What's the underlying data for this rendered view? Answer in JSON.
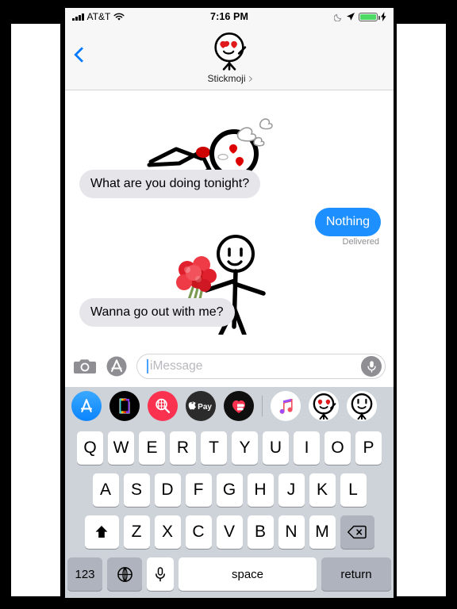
{
  "status_bar": {
    "carrier": "AT&T",
    "time": "7:16 PM",
    "signal_icon": "cellular-bars-icon",
    "wifi_icon": "wifi-icon",
    "dnd_icon": "moon-icon",
    "location_icon": "location-arrow-icon",
    "battery_icon": "battery-icon",
    "charging_icon": "lightning-bolt-icon",
    "battery_color": "#4cd964"
  },
  "nav": {
    "back_icon": "back-chevron-icon",
    "contact_name": "Stickmoji",
    "contact_chevron_icon": "chevron-right-icon",
    "avatar_icon": "stickmoji-heart-eyes-avatar",
    "accent_color": "#007aff"
  },
  "conversation": {
    "messages": [
      {
        "id": "b1",
        "text": "What are you doing tonight?",
        "side": "in",
        "sticker": "stick-figure-lying-hearts-sticker"
      },
      {
        "id": "b2",
        "text": "Nothing",
        "side": "out",
        "status": "Delivered"
      },
      {
        "id": "b3",
        "text": "Wanna go out with me?",
        "side": "in",
        "sticker": "stick-figure-roses-sticker"
      }
    ],
    "delivered_label": "Delivered",
    "incoming_bubble_color": "#e5e5ea",
    "outgoing_bubble_color": "#1e8fff"
  },
  "input_bar": {
    "camera_icon": "camera-icon",
    "appstore_icon": "app-store-icon",
    "placeholder": "iMessage",
    "value": "",
    "mic_icon": "microphone-icon"
  },
  "app_drawer": {
    "apps": [
      {
        "name": "app-store-app-icon",
        "label": "App Store"
      },
      {
        "name": "photos-app-icon",
        "label": "Photos"
      },
      {
        "name": "images-search-app-icon",
        "label": "#images"
      },
      {
        "name": "apple-pay-app-icon",
        "label": "Apple Pay"
      },
      {
        "name": "digital-touch-app-icon",
        "label": "Digital Touch"
      },
      {
        "name": "music-app-icon",
        "label": "Music"
      },
      {
        "name": "stickmoji-hearts-app-icon",
        "label": "Stickmoji"
      },
      {
        "name": "stickmoji-plain-app-icon",
        "label": "Stickmoji"
      }
    ]
  },
  "keyboard": {
    "row1": [
      "Q",
      "W",
      "E",
      "R",
      "T",
      "Y",
      "U",
      "I",
      "O",
      "P"
    ],
    "row2": [
      "A",
      "S",
      "D",
      "F",
      "G",
      "H",
      "J",
      "K",
      "L"
    ],
    "row3": [
      "Z",
      "X",
      "C",
      "V",
      "B",
      "N",
      "M"
    ],
    "shift_icon": "shift-arrow-icon",
    "backspace_icon": "backspace-icon",
    "numbers_key": "123",
    "globe_icon": "globe-icon",
    "mic_icon": "microphone-icon",
    "space_key": "space",
    "return_key": "return",
    "key_color": "#ffffff",
    "special_key_color": "#aeb3bd",
    "background_color": "#ced2d9"
  }
}
